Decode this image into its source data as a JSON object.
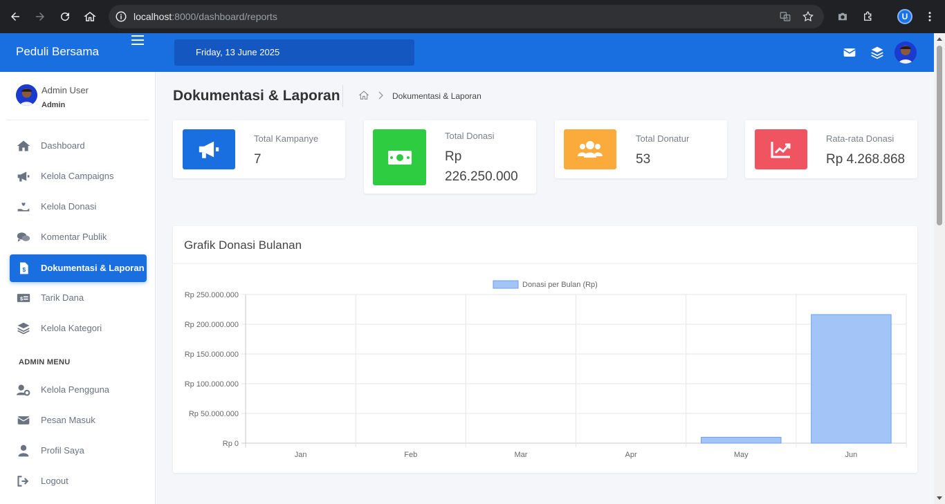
{
  "browser": {
    "url_host": "localhost",
    "url_rest": ":8000/dashboard/reports",
    "profile_initial": "U"
  },
  "app": {
    "brand": "Peduli Bersama",
    "date": "Friday, 13 June 2025"
  },
  "user": {
    "name": "Admin User",
    "role": "Admin"
  },
  "sidebar": {
    "items": [
      {
        "label": "Dashboard",
        "icon": "home-icon"
      },
      {
        "label": "Kelola Campaigns",
        "icon": "megaphone-icon"
      },
      {
        "label": "Kelola Donasi",
        "icon": "donate-hand-icon"
      },
      {
        "label": "Komentar Publik",
        "icon": "comments-icon"
      },
      {
        "label": "Dokumentasi & Laporan",
        "icon": "file-invoice-icon",
        "active": true
      },
      {
        "label": "Tarik Dana",
        "icon": "money-check-icon"
      },
      {
        "label": "Kelola Kategori",
        "icon": "layers-icon"
      }
    ],
    "section_label": "ADMIN MENU",
    "admin_items": [
      {
        "label": "Kelola Pengguna",
        "icon": "users-cog-icon"
      },
      {
        "label": "Pesan Masuk",
        "icon": "envelope-icon"
      },
      {
        "label": "Profil Saya",
        "icon": "user-icon"
      },
      {
        "label": "Logout",
        "icon": "sign-out-icon"
      }
    ]
  },
  "page": {
    "title": "Dokumentasi & Laporan",
    "breadcrumb_current": "Dokumentasi & Laporan"
  },
  "cards": [
    {
      "title": "Total Kampanye",
      "value": "7",
      "color": "#1a6fe0",
      "icon": "megaphone-icon"
    },
    {
      "title": "Total Donasi",
      "value": "Rp 226.250.000",
      "color": "#2ecc40",
      "icon": "money-bill-icon"
    },
    {
      "title": "Total Donatur",
      "value": "53",
      "color": "#fbaa3c",
      "icon": "users-icon"
    },
    {
      "title": "Rata-rata Donasi",
      "value": "Rp 4.268.868",
      "color": "#ef5460",
      "icon": "chart-line-icon"
    }
  ],
  "chart_panel": {
    "title": "Grafik Donasi Bulanan"
  },
  "chart_data": {
    "type": "bar",
    "categories": [
      "Jan",
      "Feb",
      "Mar",
      "Apr",
      "May",
      "Jun"
    ],
    "series": [
      {
        "name": "Donasi per Bulan (Rp)",
        "values": [
          0,
          0,
          0,
          0,
          10000000,
          216250000
        ]
      }
    ],
    "ylim": [
      0,
      250000000
    ],
    "yticks": [
      0,
      50000000,
      100000000,
      150000000,
      200000000,
      250000000
    ],
    "ytick_labels": [
      "Rp 0",
      "Rp 50.000.000",
      "Rp 100.000.000",
      "Rp 150.000.000",
      "Rp 200.000.000",
      "Rp 250.000.000"
    ],
    "grid": true,
    "legend": "top",
    "bar_fill": "#a3c4f7",
    "bar_stroke": "#6a9ef0"
  }
}
